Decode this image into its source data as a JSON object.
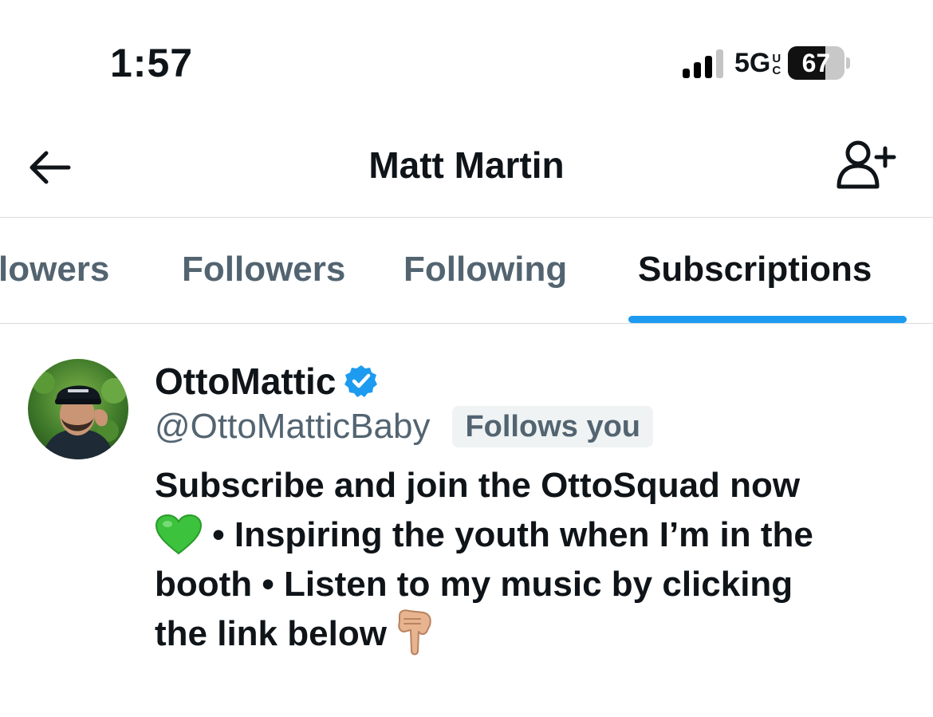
{
  "status_bar": {
    "time": "1:57",
    "network": "5G",
    "network_suffix": "UC",
    "battery_level": 67,
    "battery_text": "67"
  },
  "header": {
    "title": "Matt Martin",
    "back_icon": "arrow-left-icon",
    "action_icon": "add-user-icon"
  },
  "tabs": [
    {
      "label": "lowers",
      "active": false
    },
    {
      "label": "Followers",
      "active": false
    },
    {
      "label": "Following",
      "active": false
    },
    {
      "label": "Subscriptions",
      "active": true
    }
  ],
  "user": {
    "display_name": "OttoMattic",
    "verified": true,
    "handle": "@OttoMatticBaby",
    "badge": "Follows you",
    "bio": {
      "line1": "Subscribe and join the OttoSquad now",
      "heart_emoji": "green-heart-icon",
      "line2": " • Inspiring the youth when I’m in the",
      "line3": "booth • Listen to my music by clicking",
      "line4": "the link below ",
      "pointing_emoji": "backhand-index-pointing-down-icon"
    }
  },
  "colors": {
    "accent": "#1d9bf0",
    "text_primary": "#0f1419",
    "text_secondary": "#536471",
    "divider": "#d9dde0",
    "badge_bg": "#eff3f4"
  }
}
